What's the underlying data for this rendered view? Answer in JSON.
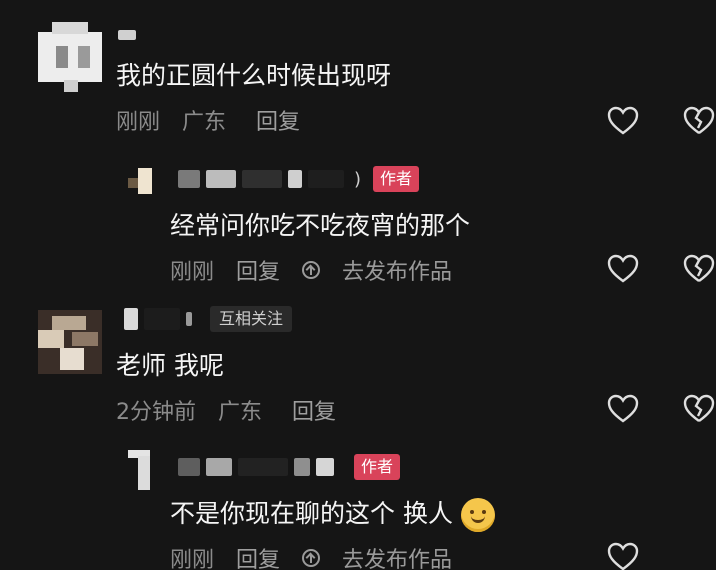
{
  "comments": [
    {
      "text": "我的正圆什么时候出现呀",
      "time": "刚刚",
      "location": "广东",
      "reply_label": "回复"
    },
    {
      "name_fragment": ")",
      "badge": "作者",
      "text": "经常问你吃不吃夜宵的那个",
      "time": "刚刚",
      "reply_label": "回复",
      "publish_label": "去发布作品"
    },
    {
      "badge": "互相关注",
      "text": "老师 我呢",
      "time": "2分钟前",
      "location": "广东",
      "reply_label": "回复"
    },
    {
      "badge": "作者",
      "text": "不是你现在聊的这个 换人",
      "emoji": "smiling-face",
      "time": "刚刚",
      "reply_label": "回复",
      "publish_label": "去发布作品"
    }
  ],
  "colors": {
    "background": "#151515",
    "author_badge": "#d9435a",
    "text": "#f5f5f5",
    "meta": "#8b8b8b"
  },
  "icons": [
    "like-heart-icon",
    "dislike-broken-heart-icon",
    "publish-upload-icon",
    "smiling-face-emoji"
  ]
}
